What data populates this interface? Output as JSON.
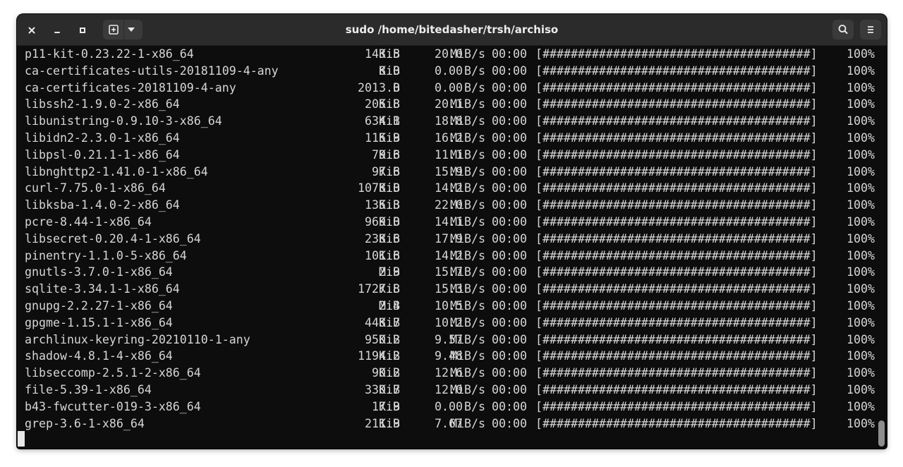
{
  "window": {
    "title": "sudo /home/bitedasher/trsh/archiso",
    "icons": {
      "close": "close-icon",
      "minimize": "minimize-icon",
      "maximize": "maximize-icon",
      "new_tab": "new-tab-icon",
      "tab_menu": "chevron-down-icon",
      "search": "search-icon",
      "menu": "hamburger-menu-icon"
    }
  },
  "colors": {
    "terminal_bg": "#0d0d0d",
    "terminal_fg": "#d6d6d6",
    "titlebar_bg": "#2b2b2b",
    "button_bg": "#3a3a3a"
  },
  "terminal": {
    "lines": [
      {
        "name": "p11-kit-0.23.22-1-x86_64",
        "size": "143.5",
        "unit": "KiB",
        "rate": "20.0",
        "rate_unit": "MiB/s",
        "time": "00:00",
        "bar": "[######################################]",
        "percent": "100%"
      },
      {
        "name": "ca-certificates-utils-20181109-4-any",
        "size": "8.0",
        "unit": "KiB",
        "rate": "0.00",
        "rate_unit": "B/s",
        "time": "00:00",
        "bar": "[######################################]",
        "percent": "100%"
      },
      {
        "name": "ca-certificates-20181109-4-any",
        "size": "2013.0",
        "unit": "B",
        "rate": "0.00",
        "rate_unit": "B/s",
        "time": "00:00",
        "bar": "[######################################]",
        "percent": "100%"
      },
      {
        "name": "libssh2-1.9.0-2-x86_64",
        "size": "205.8",
        "unit": "KiB",
        "rate": "20.1",
        "rate_unit": "MiB/s",
        "time": "00:00",
        "bar": "[######################################]",
        "percent": "100%"
      },
      {
        "name": "libunistring-0.9.10-3-x86_64",
        "size": "634.1",
        "unit": "KiB",
        "rate": "18.8",
        "rate_unit": "MiB/s",
        "time": "00:00",
        "bar": "[######################################]",
        "percent": "100%"
      },
      {
        "name": "libidn2-2.3.0-1-x86_64",
        "size": "115.9",
        "unit": "KiB",
        "rate": "16.2",
        "rate_unit": "MiB/s",
        "time": "00:00",
        "bar": "[######################################]",
        "percent": "100%"
      },
      {
        "name": "libpsl-0.21.1-1-x86_64",
        "size": "79.6",
        "unit": "KiB",
        "rate": "11.1",
        "rate_unit": "MiB/s",
        "time": "00:00",
        "bar": "[######################################]",
        "percent": "100%"
      },
      {
        "name": "libnghttp2-1.41.0-1-x86_64",
        "size": "97.6",
        "unit": "KiB",
        "rate": "15.9",
        "rate_unit": "MiB/s",
        "time": "00:00",
        "bar": "[######################################]",
        "percent": "100%"
      },
      {
        "name": "curl-7.75.0-1-x86_64",
        "size": "1078.0",
        "unit": "KiB",
        "rate": "14.2",
        "rate_unit": "MiB/s",
        "time": "00:00",
        "bar": "[######################################]",
        "percent": "100%"
      },
      {
        "name": "libksba-1.4.0-2-x86_64",
        "size": "135.3",
        "unit": "KiB",
        "rate": "22.0",
        "rate_unit": "MiB/s",
        "time": "00:00",
        "bar": "[######################################]",
        "percent": "100%"
      },
      {
        "name": "pcre-8.44-1-x86_64",
        "size": "969.0",
        "unit": "KiB",
        "rate": "14.1",
        "rate_unit": "MiB/s",
        "time": "00:00",
        "bar": "[######################################]",
        "percent": "100%"
      },
      {
        "name": "libsecret-0.20.4-1-x86_64",
        "size": "238.6",
        "unit": "KiB",
        "rate": "17.9",
        "rate_unit": "MiB/s",
        "time": "00:00",
        "bar": "[######################################]",
        "percent": "100%"
      },
      {
        "name": "pinentry-1.1.0-5-x86_64",
        "size": "101.6",
        "unit": "KiB",
        "rate": "14.2",
        "rate_unit": "MiB/s",
        "time": "00:00",
        "bar": "[######################################]",
        "percent": "100%"
      },
      {
        "name": "gnutls-3.7.0-1-x86_64",
        "size": "2.9",
        "unit": "MiB",
        "rate": "15.7",
        "rate_unit": "MiB/s",
        "time": "00:00",
        "bar": "[######################################]",
        "percent": "100%"
      },
      {
        "name": "sqlite-3.34.1-1-x86_64",
        "size": "1727.8",
        "unit": "KiB",
        "rate": "15.3",
        "rate_unit": "MiB/s",
        "time": "00:00",
        "bar": "[######################################]",
        "percent": "100%"
      },
      {
        "name": "gnupg-2.2.27-1-x86_64",
        "size": "2.4",
        "unit": "MiB",
        "rate": "10.5",
        "rate_unit": "MiB/s",
        "time": "00:00",
        "bar": "[######################################]",
        "percent": "100%"
      },
      {
        "name": "gpgme-1.15.1-1-x86_64",
        "size": "448.7",
        "unit": "KiB",
        "rate": "10.2",
        "rate_unit": "MiB/s",
        "time": "00:00",
        "bar": "[######################################]",
        "percent": "100%"
      },
      {
        "name": "archlinux-keyring-20210110-1-any",
        "size": "950.2",
        "unit": "KiB",
        "rate": "9.57",
        "rate_unit": "MiB/s",
        "time": "00:00",
        "bar": "[######################################]",
        "percent": "100%"
      },
      {
        "name": "shadow-4.8.1-4-x86_64",
        "size": "1194.2",
        "unit": "KiB",
        "rate": "9.48",
        "rate_unit": "MiB/s",
        "time": "00:00",
        "bar": "[######################################]",
        "percent": "100%"
      },
      {
        "name": "libseccomp-2.5.1-2-x86_64",
        "size": "90.2",
        "unit": "KiB",
        "rate": "12.6",
        "rate_unit": "MiB/s",
        "time": "00:00",
        "bar": "[######################################]",
        "percent": "100%"
      },
      {
        "name": "file-5.39-1-x86_64",
        "size": "330.7",
        "unit": "KiB",
        "rate": "12.0",
        "rate_unit": "MiB/s",
        "time": "00:00",
        "bar": "[######################################]",
        "percent": "100%"
      },
      {
        "name": "b43-fwcutter-019-3-x86_64",
        "size": "17.9",
        "unit": "KiB",
        "rate": "0.00",
        "rate_unit": "B/s",
        "time": "00:00",
        "bar": "[######################################]",
        "percent": "100%"
      },
      {
        "name": "grep-3.6-1-x86_64",
        "size": "211.9",
        "unit": "KiB",
        "rate": "7.67",
        "rate_unit": "MiB/s",
        "time": "00:00",
        "bar": "[######################################]",
        "percent": "100%"
      }
    ]
  }
}
